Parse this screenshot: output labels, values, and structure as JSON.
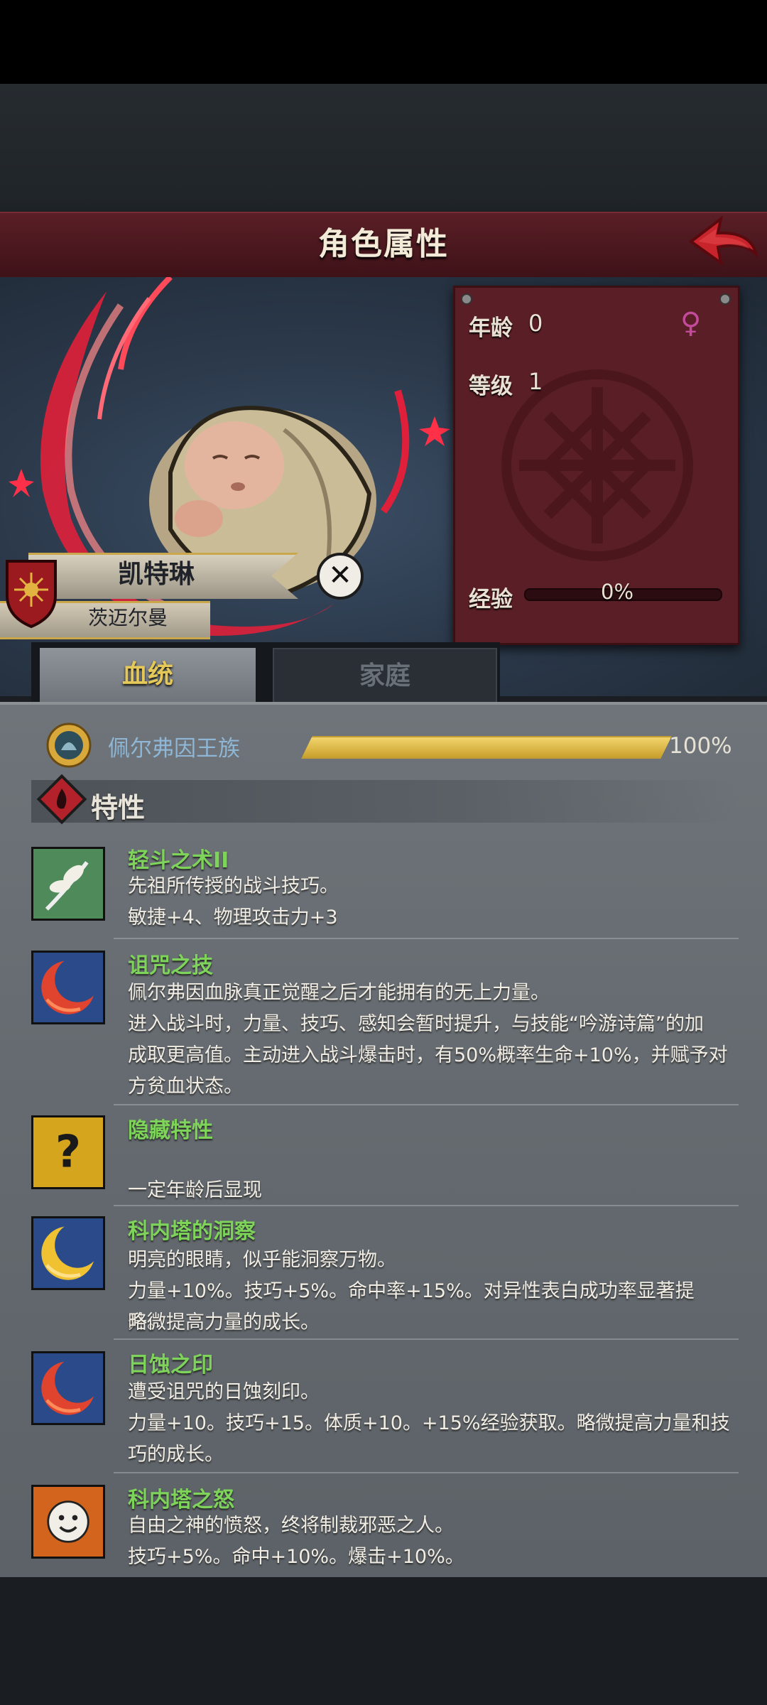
{
  "header": {
    "title": "角色属性",
    "back_icon": "back-arrow-icon"
  },
  "character": {
    "name": "凯特琳",
    "house": "茨迈尔曼",
    "gender_icon": "female-icon",
    "stats": {
      "age_label": "年龄",
      "age": "0",
      "level_label": "等级",
      "level": "1",
      "exp_label": "经验",
      "exp_percent": "0%",
      "exp_fraction": 0.0
    }
  },
  "tabs": [
    {
      "label": "血统",
      "active": true
    },
    {
      "label": "家庭",
      "active": false
    }
  ],
  "lineage": {
    "name": "佩尔弗因王族",
    "percent": "100%",
    "fraction": 1.0
  },
  "traits_section": {
    "title": "特性"
  },
  "traits": [
    {
      "icon": "feather-plant-icon",
      "name": "轻斗之术II",
      "lines": [
        "先祖所传授的战斗技巧。",
        "敏捷+4、物理攻击力+3"
      ]
    },
    {
      "icon": "red-crescent-icon",
      "name": "诅咒之技",
      "lines": [
        "佩尔弗因血脉真正觉醒之后才能拥有的无上力量。",
        "进入战斗时，力量、技巧、感知会暂时提升，与技能“吟游诗篇”的加",
        "成取更高值。主动进入战斗爆击时，有50%概率生命+10%，并赋予对",
        "方贫血状态。"
      ]
    },
    {
      "icon": "question-mark-icon",
      "name": "隐藏特性",
      "lines": [
        "",
        "一定年龄后显现"
      ]
    },
    {
      "icon": "gold-crescent-icon",
      "name": "科内塔的洞察",
      "lines": [
        "明亮的眼睛，似乎能洞察万物。",
        "力量+10%。技巧+5%。命中率+15%。对异性表白成功率显著提升。",
        "略微提高力量的成长。"
      ]
    },
    {
      "icon": "red-crescent-icon",
      "name": "日蚀之印",
      "lines": [
        "遭受诅咒的日蚀刻印。",
        "力量+10。技巧+15。体质+10。+15%经验获取。略微提高力量和技",
        "巧的成长。"
      ]
    },
    {
      "icon": "smiling-sun-icon",
      "name": "科内塔之怒",
      "lines": [
        "自由之神的愤怒，终将制裁邪恶之人。",
        "技巧+5%。命中+10%。爆击+10%。"
      ]
    }
  ],
  "colors": {
    "accent_gold": "#e4c85a",
    "trait_name_green": "#7ed35a",
    "banner_red": "#5a1e26"
  }
}
